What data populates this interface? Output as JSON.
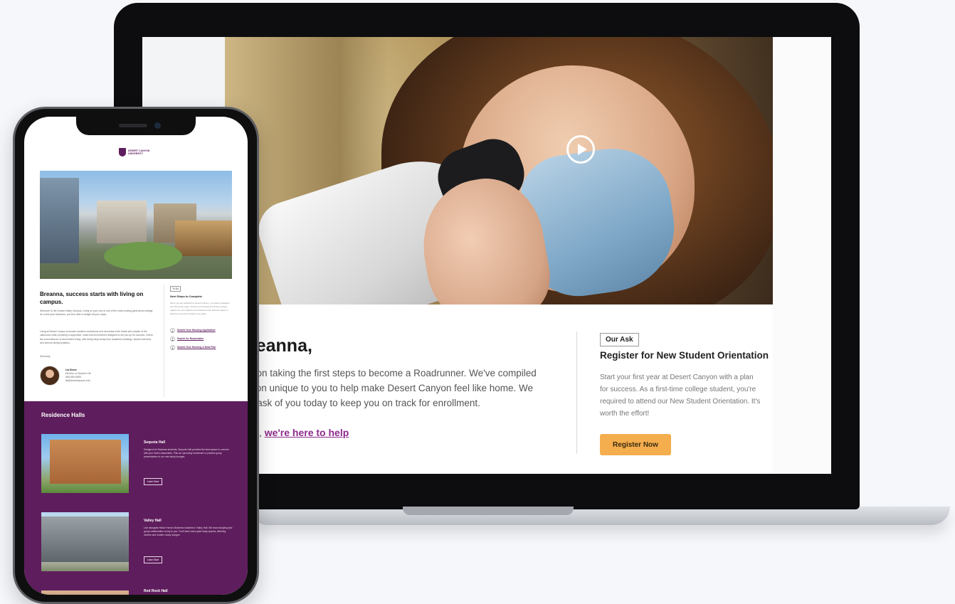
{
  "laptop": {
    "greeting": "reanna,",
    "body_lines": [
      "s on taking the first steps to become a Roadrunner. We've compiled",
      "sion unique to you to help make Desert Canyon feel like home. We",
      "e ask of you today to keep you on track for enrollment."
    ],
    "help_prefix": "ys,",
    "help_link": "we're here to help",
    "ask_badge": "Our Ask",
    "ask_title": "Register for New Student Orientation",
    "ask_body_lines": [
      "Start your first year at Desert Canyon with a plan",
      "for success. As a first-time college student, you're",
      "required to attend our New Student Orientation. It's",
      "worth the effort!"
    ],
    "register_button": "Register Now"
  },
  "phone": {
    "logo_text_1": "DESERT CANYON",
    "logo_text_2": "UNIVERSITY",
    "headline": "Breanna, success starts with living on campus.",
    "para1": "Welcome to the Sunset Valley Campus. Living on your own is one of the most exciting parts about college. As a first-year freshman, you'll be able to delight all your stops.",
    "para2": "Living at Desert Canyon promotes student connections and innovation both inside and outside of the classroom while providing a supportive, close-knit environment designed to set you up for success. Check the conveniences of all-inclusive living, with being steps away from academic buildings, student services and various dining locations.",
    "sig_label": "Sincerely,",
    "sig_name": "Lia Dione",
    "sig_title": "Director of Student Life",
    "sig_phone": "555-555-5555",
    "sig_email": "lia@desertcanyon.edu",
    "next_steps_badge": "To Do",
    "next_steps_title": "Next Steps to Complete",
    "next_steps_body": "Since you are admitted to Desert Canyon, you have completed your first three steps. Finish your housing and dining, please, register for your classes and residence hall. We'll be happy to assist as you work towards your goals.",
    "steps": [
      "Submit Your Housing Application",
      "Search for Roommates",
      "Submit Your Housing & Meal Plan"
    ],
    "residence_title": "Residence Halls",
    "halls": [
      {
        "name": "Sequoia Hall",
        "desc": "Designed for Business students, Sequoia Hall provides the ideal space to connect with your future classmates. Plan an upcoming homework or practice group presentations in our new study lounges.",
        "button": "Learn More"
      },
      {
        "name": "Valley Hall",
        "desc": "Live alongside fellow Honors Business students in Valley Hall. We know studying and group collaboration is key to you. You'll have extra quiet study spaces, listening centers and modern study lounges.",
        "button": "Learn More"
      },
      {
        "name": "Red Rock Hall"
      }
    ]
  },
  "colors": {
    "brand_purple": "#5e1d5c",
    "cta_orange": "#f4ae4e",
    "link_purple": "#8c2a8a"
  },
  "icons": [
    "play-icon",
    "university-logo-icon"
  ]
}
